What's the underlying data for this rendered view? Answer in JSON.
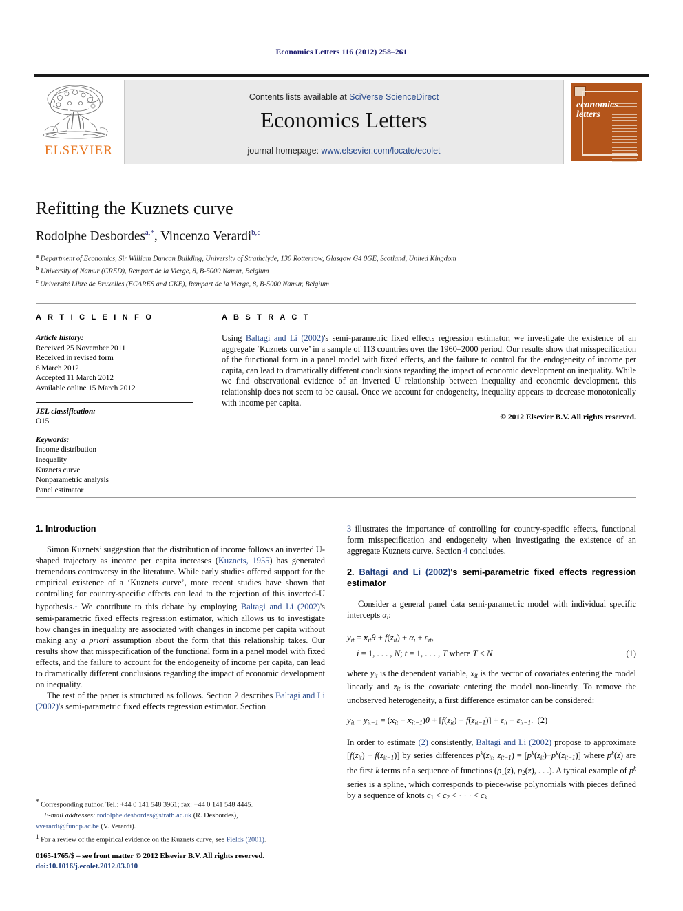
{
  "running_head": "Economics Letters 116 (2012) 258–261",
  "masthead": {
    "contents_prefix": "Contents lists available at ",
    "contents_link": "SciVerse ScienceDirect",
    "journal_name": "Economics Letters",
    "homepage_prefix": "journal homepage: ",
    "homepage_url": "www.elsevier.com/locate/ecolet",
    "publisher_wordmark": "ELSEVIER",
    "cover_title_line1": "economics",
    "cover_title_line2": "letters",
    "cover_accent_color": "#b4551b",
    "link_color": "#2a4b8d",
    "elsevier_orange": "#e87722"
  },
  "article": {
    "title": "Refitting the Kuznets curve",
    "authors": [
      {
        "name": "Rodolphe Desbordes",
        "marks": "a,*"
      },
      {
        "name": "Vincenzo Verardi",
        "marks": "b,c"
      }
    ],
    "affiliations": [
      {
        "mark": "a",
        "text": "Department of Economics, Sir William Duncan Building, University of Strathclyde, 130 Rottenrow, Glasgow G4 0GE, Scotland, United Kingdom"
      },
      {
        "mark": "b",
        "text": "University of Namur (CRED), Rempart de la Vierge, 8, B-5000 Namur, Belgium"
      },
      {
        "mark": "c",
        "text": "Université Libre de Bruxelles (ECARES and CKE), Rempart de la Vierge, 8, B-5000 Namur, Belgium"
      }
    ]
  },
  "article_info": {
    "heading": "A R T I C L E   I N F O",
    "history_label": "Article history:",
    "history": [
      "Received 25 November 2011",
      "Received in revised form",
      "6 March 2012",
      "Accepted 11 March 2012",
      "Available online 15 March 2012"
    ],
    "jel_label": "JEL classification:",
    "jel_codes": "O15",
    "keywords_label": "Keywords:",
    "keywords": [
      "Income distribution",
      "Inequality",
      "Kuznets curve",
      "Nonparametric analysis",
      "Panel estimator"
    ]
  },
  "abstract": {
    "heading": "A B S T R A C T",
    "part1": "Using ",
    "ref1": "Baltagi and Li (2002)",
    "part2": "'s semi-parametric fixed effects regression estimator, we investigate the existence of an aggregate ‘Kuznets curve’ in a sample of 113 countries over the 1960–2000 period. Our results show that misspecification of the functional form in a panel model with fixed effects, and the failure to control for the endogeneity of income per capita, can lead to dramatically different conclusions regarding the impact of economic development on inequality. While we find observational evidence of an inverted U relationship between inequality and economic development, this relationship does not seem to be causal. Once we account for endogeneity, inequality appears to decrease monotonically with income per capita.",
    "copyright": "© 2012 Elsevier B.V. All rights reserved."
  },
  "sections": {
    "intro_heading": "1. Introduction",
    "intro_p1_a": "Simon Kuznets’ suggestion that the distribution of income follows an inverted U-shaped trajectory as income per capita increases (",
    "intro_p1_ref1": "Kuznets, 1955",
    "intro_p1_b": ") has generated tremendous controversy in the literature. While early studies offered support for the empirical existence of a ‘Kuznets curve’, more recent studies have shown that controlling for country-specific effects can lead to the rejection of this inverted-U hypothesis.",
    "intro_p1_fnmark": "1",
    "intro_p1_c": " We contribute to this debate by employing ",
    "intro_p1_ref2": "Baltagi and Li (2002)",
    "intro_p1_d": "'s semi-parametric fixed effects regression estimator, which allows us to investigate how changes in inequality are associated with changes in income per capita without making any ",
    "intro_p1_italic": "a priori",
    "intro_p1_e": " assumption about the form that this relationship takes. Our results show that misspecification of the functional form in a panel model with fixed effects, and the failure to account for the endogeneity of income per capita, can lead to dramatically different conclusions regarding the impact of economic development on inequality.",
    "intro_p2_a": "The rest of the paper is structured as follows. Section 2 describes ",
    "intro_p2_ref1": "Baltagi and Li (2002)",
    "intro_p2_b": "'s semi-parametric fixed effects regression estimator. Section ",
    "intro_p2_ref2": "3",
    "intro_p2_c": " illustrates the importance of controlling for country-specific effects, functional form misspecification and endogeneity when investigating the existence of an aggregate Kuznets curve. Section ",
    "intro_p2_ref3": "4",
    "intro_p2_d": " concludes.",
    "sec2_num": "2. ",
    "sec2_ref": "Baltagi and Li (2002)",
    "sec2_rest": "'s semi-parametric fixed effects regression estimator",
    "sec2_p1_a": "Consider a general panel data semi-parametric model with individual specific intercepts ",
    "sec2_p1_math": "αi",
    "sec2_p1_b": ":",
    "eq1_line1": "yit = xitθ + f(zit) + αi + εit,",
    "eq1_line2": "i = 1, . . . , N; t = 1, . . . , T  where T < N",
    "eq1_num": "(1)",
    "sec2_p2": "where yit is the dependent variable, xit is the vector of covariates entering the model linearly and zit is the covariate entering the model non-linearly. To remove the unobserved heterogeneity, a first difference estimator can be considered:",
    "eq2": "yit − yit−1 = (xit − xit−1)θ + [f(zit) − f(zit−1)] + εit − εit−1.",
    "eq2_num": "(2)",
    "sec2_p3_a": "In order to estimate ",
    "sec2_p3_eqref": "(2)",
    "sec2_p3_b": " consistently, ",
    "sec2_p3_ref": "Baltagi and Li (2002)",
    "sec2_p3_c": " propose to approximate [f(zit) − f(zit−1)] by series differences pk(zit, zit−1) = [pk(zit)−pk(zit−1)] where pk(z) are the first k terms of a sequence of functions (p1(z), p2(z), . . .). A typical example of pk series is a spline, which corresponds to piece-wise polynomials with pieces defined by a sequence of knots c1 < c2 < · · · < ck"
  },
  "footnotes": {
    "corresponding_mark": "*",
    "corresponding": "Corresponding author. Tel.: +44 0 141 548 3961; fax: +44 0 141 548 4445.",
    "email_label": "E-mail addresses:",
    "email1": "rodolphe.desbordes@strath.ac.uk",
    "email1_who": "(R. Desbordes),",
    "email2": "vverardi@fundp.ac.be",
    "email2_who": "(V. Verardi).",
    "fn1_mark": "1",
    "fn1_a": "For a review of the empirical evidence on the Kuznets curve, see ",
    "fn1_ref": "Fields (2001)",
    "fn1_b": ".",
    "imprint": "0165-1765/$ – see front matter © 2012 Elsevier B.V. All rights reserved.",
    "doi": "doi:10.1016/j.ecolet.2012.03.010"
  }
}
